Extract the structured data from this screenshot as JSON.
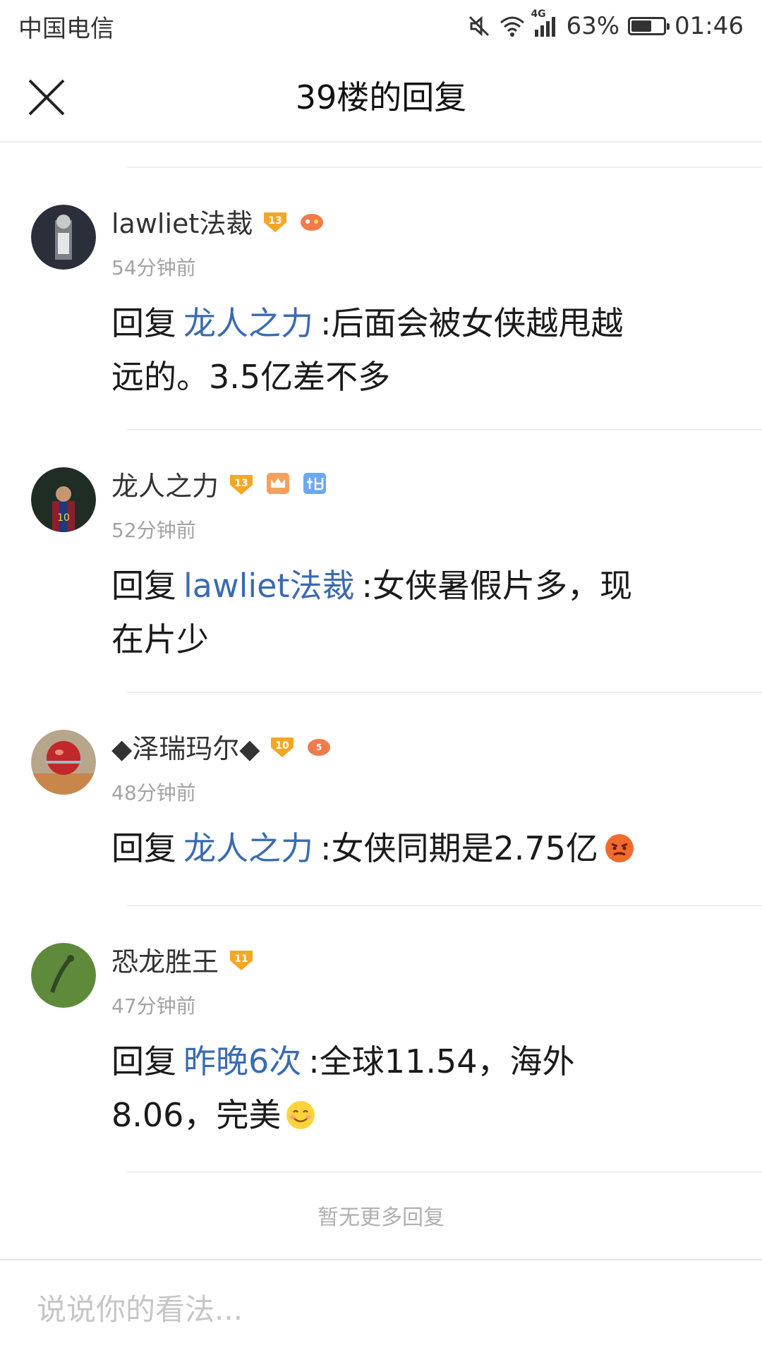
{
  "status_bar": {
    "carrier": "中国电信",
    "network": "4G",
    "battery": "63%",
    "battery_level": 0.63,
    "time": "01:46"
  },
  "header": {
    "title": "39楼的回复",
    "close_icon": "close-icon"
  },
  "comments": [
    {
      "username": "lawliet法裁",
      "level": "13",
      "time": "54分钟前",
      "reply_prefix": "回复",
      "reply_to": "龙人之力",
      "text_line1": ":后面会被女侠越甩越",
      "text_line2": "远的。3.5亿差不多"
    },
    {
      "username": "龙人之力",
      "level": "13",
      "time": "52分钟前",
      "reply_prefix": "回复",
      "reply_to": "lawliet法裁",
      "text_line1": ":女侠暑假片多，现",
      "text_line2": "在片少"
    },
    {
      "username": "◆泽瑞玛尔◆",
      "level": "10",
      "time": "48分钟前",
      "reply_prefix": "回复",
      "reply_to": "龙人之力",
      "text_line1": ":女侠同期是2.75亿",
      "text_line2": ""
    },
    {
      "username": "恐龙胜王",
      "level": "11",
      "time": "47分钟前",
      "reply_prefix": "回复",
      "reply_to": "昨晚6次",
      "text_line1": ":全球11.54，海外",
      "text_line2": "8.06，完美"
    }
  ],
  "footer": {
    "no_more": "暂无更多回复",
    "input_placeholder": "说说你的看法..."
  },
  "colors": {
    "link": "#3a6bb2",
    "level_badge": "#f5a623",
    "divider": "#eeeeee"
  }
}
